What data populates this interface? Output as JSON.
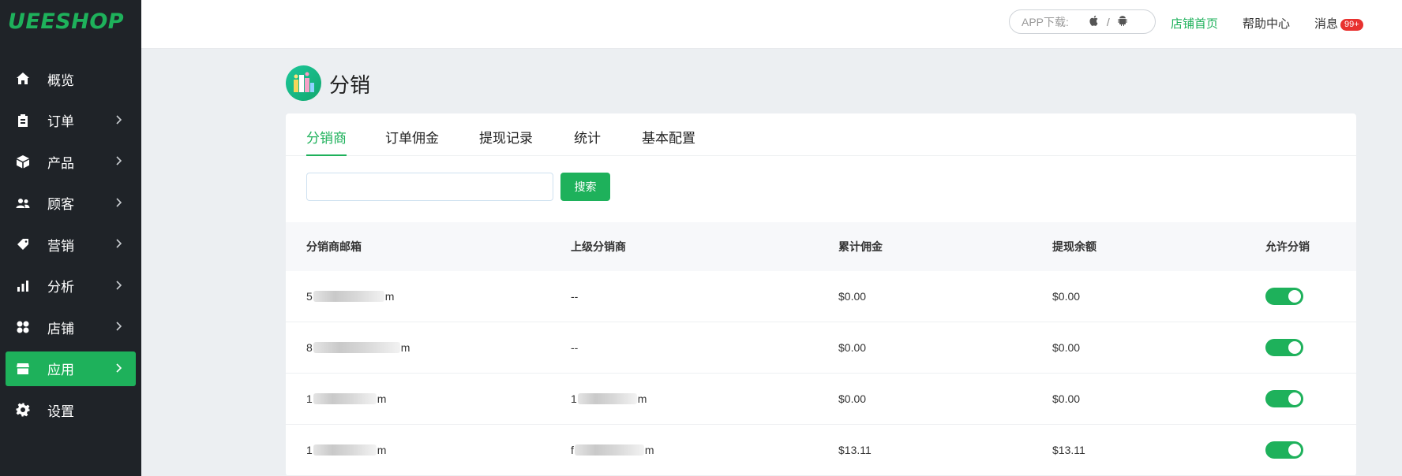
{
  "sidebar": {
    "logo": "UEESHOP",
    "items": [
      {
        "label": "概览",
        "icon": "home-icon",
        "arrow": false
      },
      {
        "label": "订单",
        "icon": "clipboard-icon",
        "arrow": true
      },
      {
        "label": "产品",
        "icon": "box-icon",
        "arrow": true
      },
      {
        "label": "顾客",
        "icon": "users-icon",
        "arrow": true
      },
      {
        "label": "营销",
        "icon": "tag-icon",
        "arrow": true
      },
      {
        "label": "分析",
        "icon": "bar-chart-icon",
        "arrow": true
      },
      {
        "label": "店铺",
        "icon": "grid-icon",
        "arrow": true
      },
      {
        "label": "应用",
        "icon": "store-icon",
        "arrow": true,
        "active": true
      },
      {
        "label": "设置",
        "icon": "gear-icon",
        "arrow": false
      }
    ]
  },
  "topbar": {
    "app_download_label": "APP下载:",
    "separator": "/",
    "store_home": "店铺首页",
    "help_center": "帮助中心",
    "messages": "消息",
    "messages_badge": "99+"
  },
  "page": {
    "title": "分销"
  },
  "tabs": [
    "分销商",
    "订单佣金",
    "提现记录",
    "统计",
    "基本配置"
  ],
  "active_tab": 0,
  "search": {
    "value": "",
    "button": "搜索"
  },
  "table": {
    "headers": [
      "分销商邮箱",
      "上级分销商",
      "累计佣金",
      "提现余额",
      "允许分销"
    ],
    "rows": [
      {
        "email_pre": "5",
        "email_post": "m",
        "parent": "--",
        "parent_pre": "",
        "parent_post": "",
        "commission": "$0.00",
        "balance": "$0.00",
        "allowed": true
      },
      {
        "email_pre": "8",
        "email_post": "m",
        "parent": "--",
        "parent_pre": "",
        "parent_post": "",
        "commission": "$0.00",
        "balance": "$0.00",
        "allowed": true
      },
      {
        "email_pre": "1",
        "email_post": "m",
        "parent": "",
        "parent_pre": "1",
        "parent_post": "m",
        "commission": "$0.00",
        "balance": "$0.00",
        "allowed": true
      },
      {
        "email_pre": "1",
        "email_post": "m",
        "parent": "",
        "parent_pre": "f",
        "parent_post": "m",
        "commission": "$13.11",
        "balance": "$13.11",
        "allowed": true
      }
    ]
  },
  "colors": {
    "accent": "#1eb15b",
    "sidebar_bg": "#1f2328",
    "badge": "#e8322f"
  }
}
